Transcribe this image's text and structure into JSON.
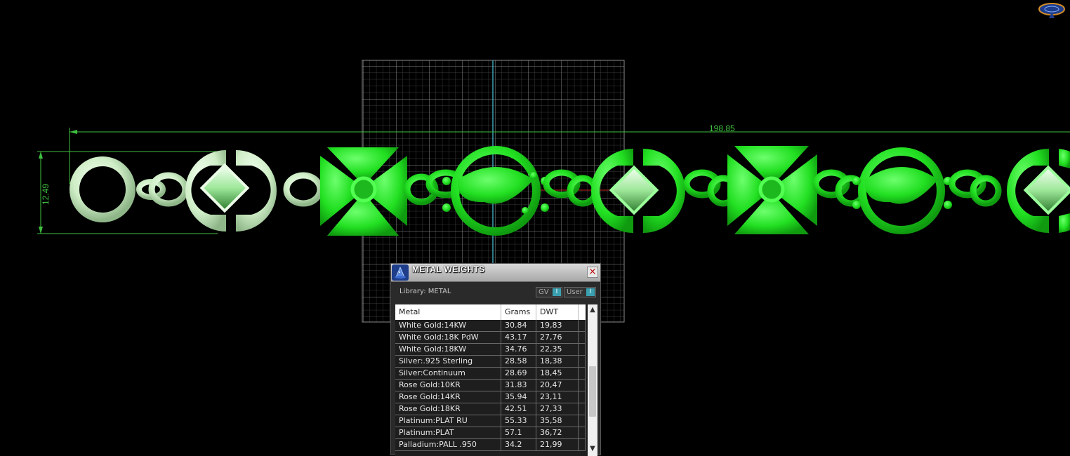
{
  "viewport": {
    "dimension_length": "198.85",
    "dimension_height": "12.49"
  },
  "metal_panel": {
    "title": "METAL WEIGHTS",
    "close_label": "×",
    "library_label": "Library: METAL",
    "toggle_gv_label": "GV",
    "toggle_user_label": "User",
    "toggle_gv_state": "I",
    "toggle_user_state": "I",
    "columns": [
      "Metal",
      "Grams",
      "DWT"
    ],
    "rows": [
      {
        "metal": "White Gold:14KW",
        "grams": "30.84",
        "dwt": "19,83"
      },
      {
        "metal": "White Gold:18K PdW",
        "grams": "43.17",
        "dwt": "27,76"
      },
      {
        "metal": "White Gold:18KW",
        "grams": "34.76",
        "dwt": "22,35"
      },
      {
        "metal": "Silver:.925 Sterling",
        "grams": "28.58",
        "dwt": "18,38"
      },
      {
        "metal": "Silver:Continuum",
        "grams": "28.69",
        "dwt": "18,45"
      },
      {
        "metal": "Rose Gold:10KR",
        "grams": "31.83",
        "dwt": "20,47"
      },
      {
        "metal": "Rose Gold:14KR",
        "grams": "35.94",
        "dwt": "23,11"
      },
      {
        "metal": "Rose Gold:18KR",
        "grams": "42.51",
        "dwt": "27,33"
      },
      {
        "metal": "Platinum:PLAT RU",
        "grams": "55.33",
        "dwt": "35,58"
      },
      {
        "metal": "Platinum:PLAT",
        "grams": "57.1",
        "dwt": "36,72"
      },
      {
        "metal": "Palladium:PALL .950",
        "grams": "34.2",
        "dwt": "21,99"
      }
    ]
  },
  "colors": {
    "selected_green": "#2ee82e",
    "unselected_pale": "#d4f2cc",
    "dimension_green": "#3fc13f",
    "grid": "#7a7a7a",
    "axis": "#3aa0b0"
  }
}
